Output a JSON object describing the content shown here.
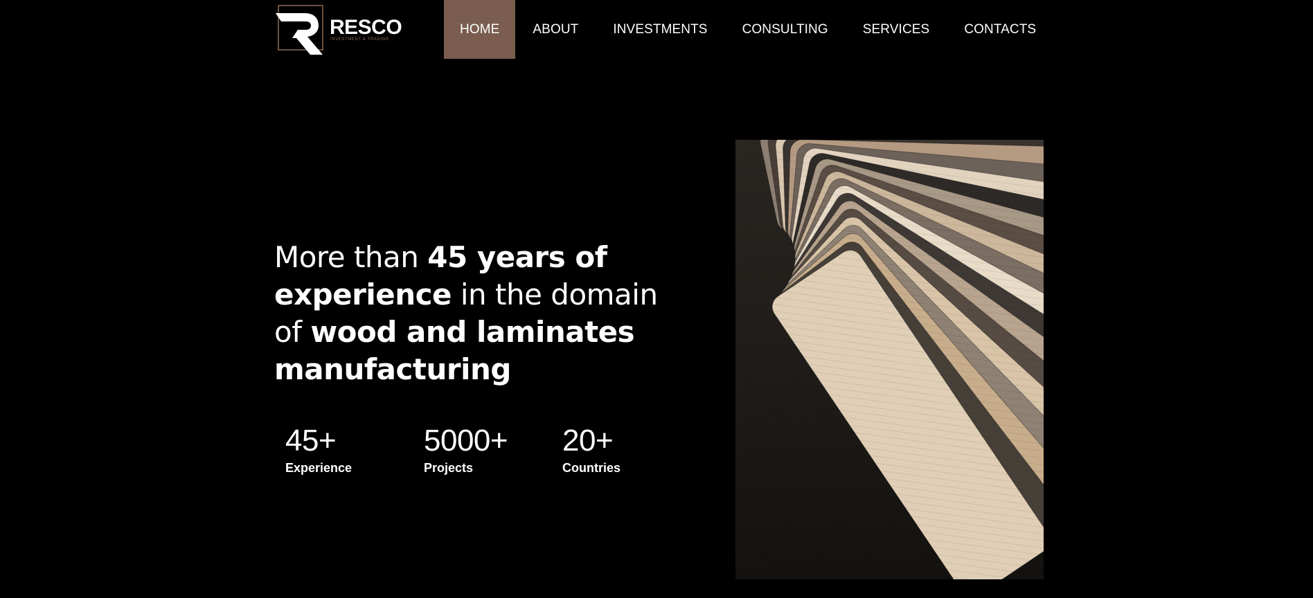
{
  "brand": {
    "name": "RESCO",
    "tagline": "INVESTMENT & TRADING",
    "logo_icon": "resco-r-logo-icon"
  },
  "nav": {
    "items": [
      {
        "label": "HOME",
        "active": true
      },
      {
        "label": "ABOUT",
        "active": false
      },
      {
        "label": "INVESTMENTS",
        "active": false
      },
      {
        "label": "CONSULTING",
        "active": false
      },
      {
        "label": "SERVICES",
        "active": false
      },
      {
        "label": "CONTACTS",
        "active": false
      }
    ]
  },
  "hero": {
    "heading": {
      "part1": "More than ",
      "bold1": "45 years of experience",
      "part2": " in the domain of ",
      "bold2": "wood and laminates manufacturing"
    },
    "stats": [
      {
        "value": "45+",
        "label": "Experience"
      },
      {
        "value": "5000+",
        "label": "Projects"
      },
      {
        "value": "20+",
        "label": "Countries"
      }
    ],
    "image_icon": "wood-laminate-samples-image"
  },
  "colors": {
    "background": "#000000",
    "accent": "#7a5d4e",
    "text": "#ffffff"
  }
}
